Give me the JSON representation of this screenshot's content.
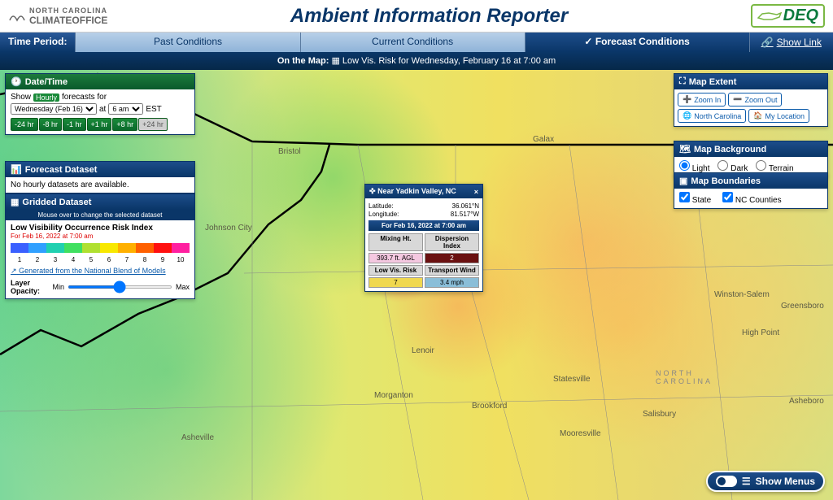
{
  "header": {
    "logo_left_line1": "NORTH CAROLINA",
    "logo_left_line2": "CLIMATEOFFICE",
    "title": "Ambient Information Reporter",
    "logo_right": "DEQ"
  },
  "tabs": {
    "time_period_label": "Time Period:",
    "past": "Past Conditions",
    "current": "Current Conditions",
    "forecast": "Forecast Conditions",
    "show_link": "Show Link"
  },
  "on_map": {
    "label": "On the Map:",
    "desc": "Low Vis. Risk for Wednesday, February 16 at 7:00 am"
  },
  "datetime": {
    "header": "Date/Time",
    "show": "Show",
    "hourly": "Hourly",
    "forecasts_for": "forecasts for",
    "date_sel": "Wednesday (Feb 16)",
    "at": "at",
    "time_sel": "6 am",
    "tz": "EST",
    "btns": [
      "-24 hr",
      "-8 hr",
      "-1 hr",
      "+1 hr",
      "+8 hr",
      "+24 hr"
    ]
  },
  "forecast_ds": {
    "header": "Forecast Dataset",
    "msg": "No hourly datasets are available."
  },
  "gridded": {
    "header": "Gridded Dataset",
    "sub": "Mouse over to change the selected dataset",
    "index_label": "Low Visibility Occurrence Risk Index",
    "for_date": "For Feb 16, 2022 at 7:00 am",
    "nums": [
      "1",
      "2",
      "3",
      "4",
      "5",
      "6",
      "7",
      "8",
      "9",
      "10"
    ],
    "colors": [
      "#3a60ff",
      "#30a0ff",
      "#20d0b0",
      "#40e060",
      "#b0e030",
      "#f8e800",
      "#ffb000",
      "#ff6000",
      "#ff1010",
      "#ff20a0"
    ],
    "gen_link": "Generated from the National Blend of Models",
    "opacity_label": "Layer Opacity:",
    "min": "Min",
    "max": "Max"
  },
  "popup": {
    "header": "Near Yadkin Valley, NC",
    "lat_l": "Latitude:",
    "lat_v": "36.061°N",
    "lon_l": "Longitude:",
    "lon_v": "81.517°W",
    "time": "For Feb 16, 2022 at 7:00 am",
    "mixing_h": "Mixing Ht.",
    "mixing_v": "393.7 ft. AGL",
    "disp_h": "Dispersion Index",
    "disp_v": "2",
    "lowvis_h": "Low Vis. Risk",
    "lowvis_v": "7",
    "trans_h": "Transport Wind",
    "trans_v": "3.4 mph"
  },
  "extent": {
    "header": "Map Extent",
    "zoom_in": "Zoom In",
    "zoom_out": "Zoom Out",
    "nc": "North Carolina",
    "my_loc": "My Location"
  },
  "bg": {
    "header": "Map Background",
    "light": "Light",
    "dark": "Dark",
    "terrain": "Terrain"
  },
  "bound": {
    "header": "Map Boundaries",
    "state": "State",
    "counties": "NC Counties"
  },
  "show_menus": "Show Menus",
  "cities": {
    "galax": "Galax",
    "bristol": "Bristol",
    "johnson": "Johnson City",
    "lenoir": "Lenoir",
    "morganton": "Morganton",
    "statesville": "Statesville",
    "brookford": "Brookford",
    "winston": "Winston-Salem",
    "greensboro": "Greensboro",
    "highpoint": "High Point",
    "asheboro": "Asheboro",
    "salisbury": "Salisbury",
    "mooresville": "Mooresville",
    "asheville": "Asheville",
    "ncarolina": "NORTH\nCAROLINA"
  }
}
